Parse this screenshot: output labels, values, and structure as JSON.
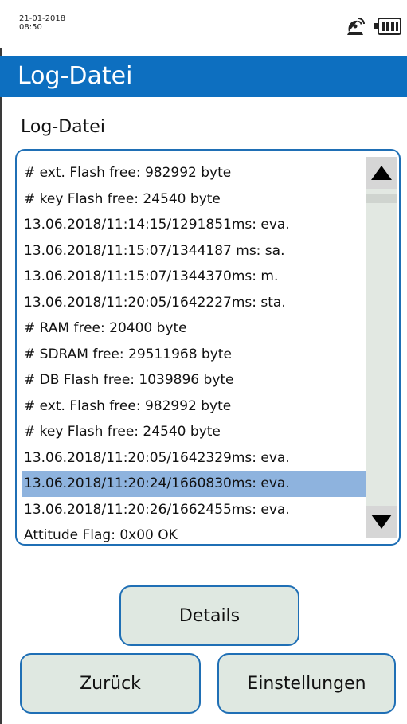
{
  "status_bar": {
    "date": "21-01-2018",
    "time": "08:50",
    "icons": [
      "satellite-icon",
      "battery-icon"
    ]
  },
  "header": {
    "title": "Log-Datei"
  },
  "section": {
    "label": "Log-Datei"
  },
  "log": {
    "lines": [
      "# ext. Flash free: 982992 byte",
      "# key Flash free: 24540 byte",
      "13.06.2018/11:14:15/1291851ms: eva.",
      "13.06.2018/11:15:07/1344187 ms: sa.",
      "13.06.2018/11:15:07/1344370ms: m.",
      "13.06.2018/11:20:05/1642227ms: sta.",
      "# RAM free: 20400 byte",
      "# SDRAM free: 29511968 byte",
      "# DB Flash free: 1039896 byte",
      "# ext. Flash free: 982992 byte",
      "# key Flash free: 24540 byte",
      "13.06.2018/11:20:05/1642329ms: eva.",
      "13.06.2018/11:20:24/1660830ms: eva.",
      "13.06.2018/11:20:26/1662455ms: eva.",
      "Attitude Flag: 0x00 OK"
    ],
    "selected_index": 12,
    "scroll_icons": [
      "scroll-up-icon",
      "scroll-down-icon"
    ]
  },
  "buttons": {
    "details": "Details",
    "back": "Zurück",
    "settings": "Einstellungen"
  },
  "colors": {
    "accent": "#0d6fc0",
    "border": "#1f6fb5",
    "selection": "#8eb3de",
    "button_bg": "#dfe8e1"
  }
}
